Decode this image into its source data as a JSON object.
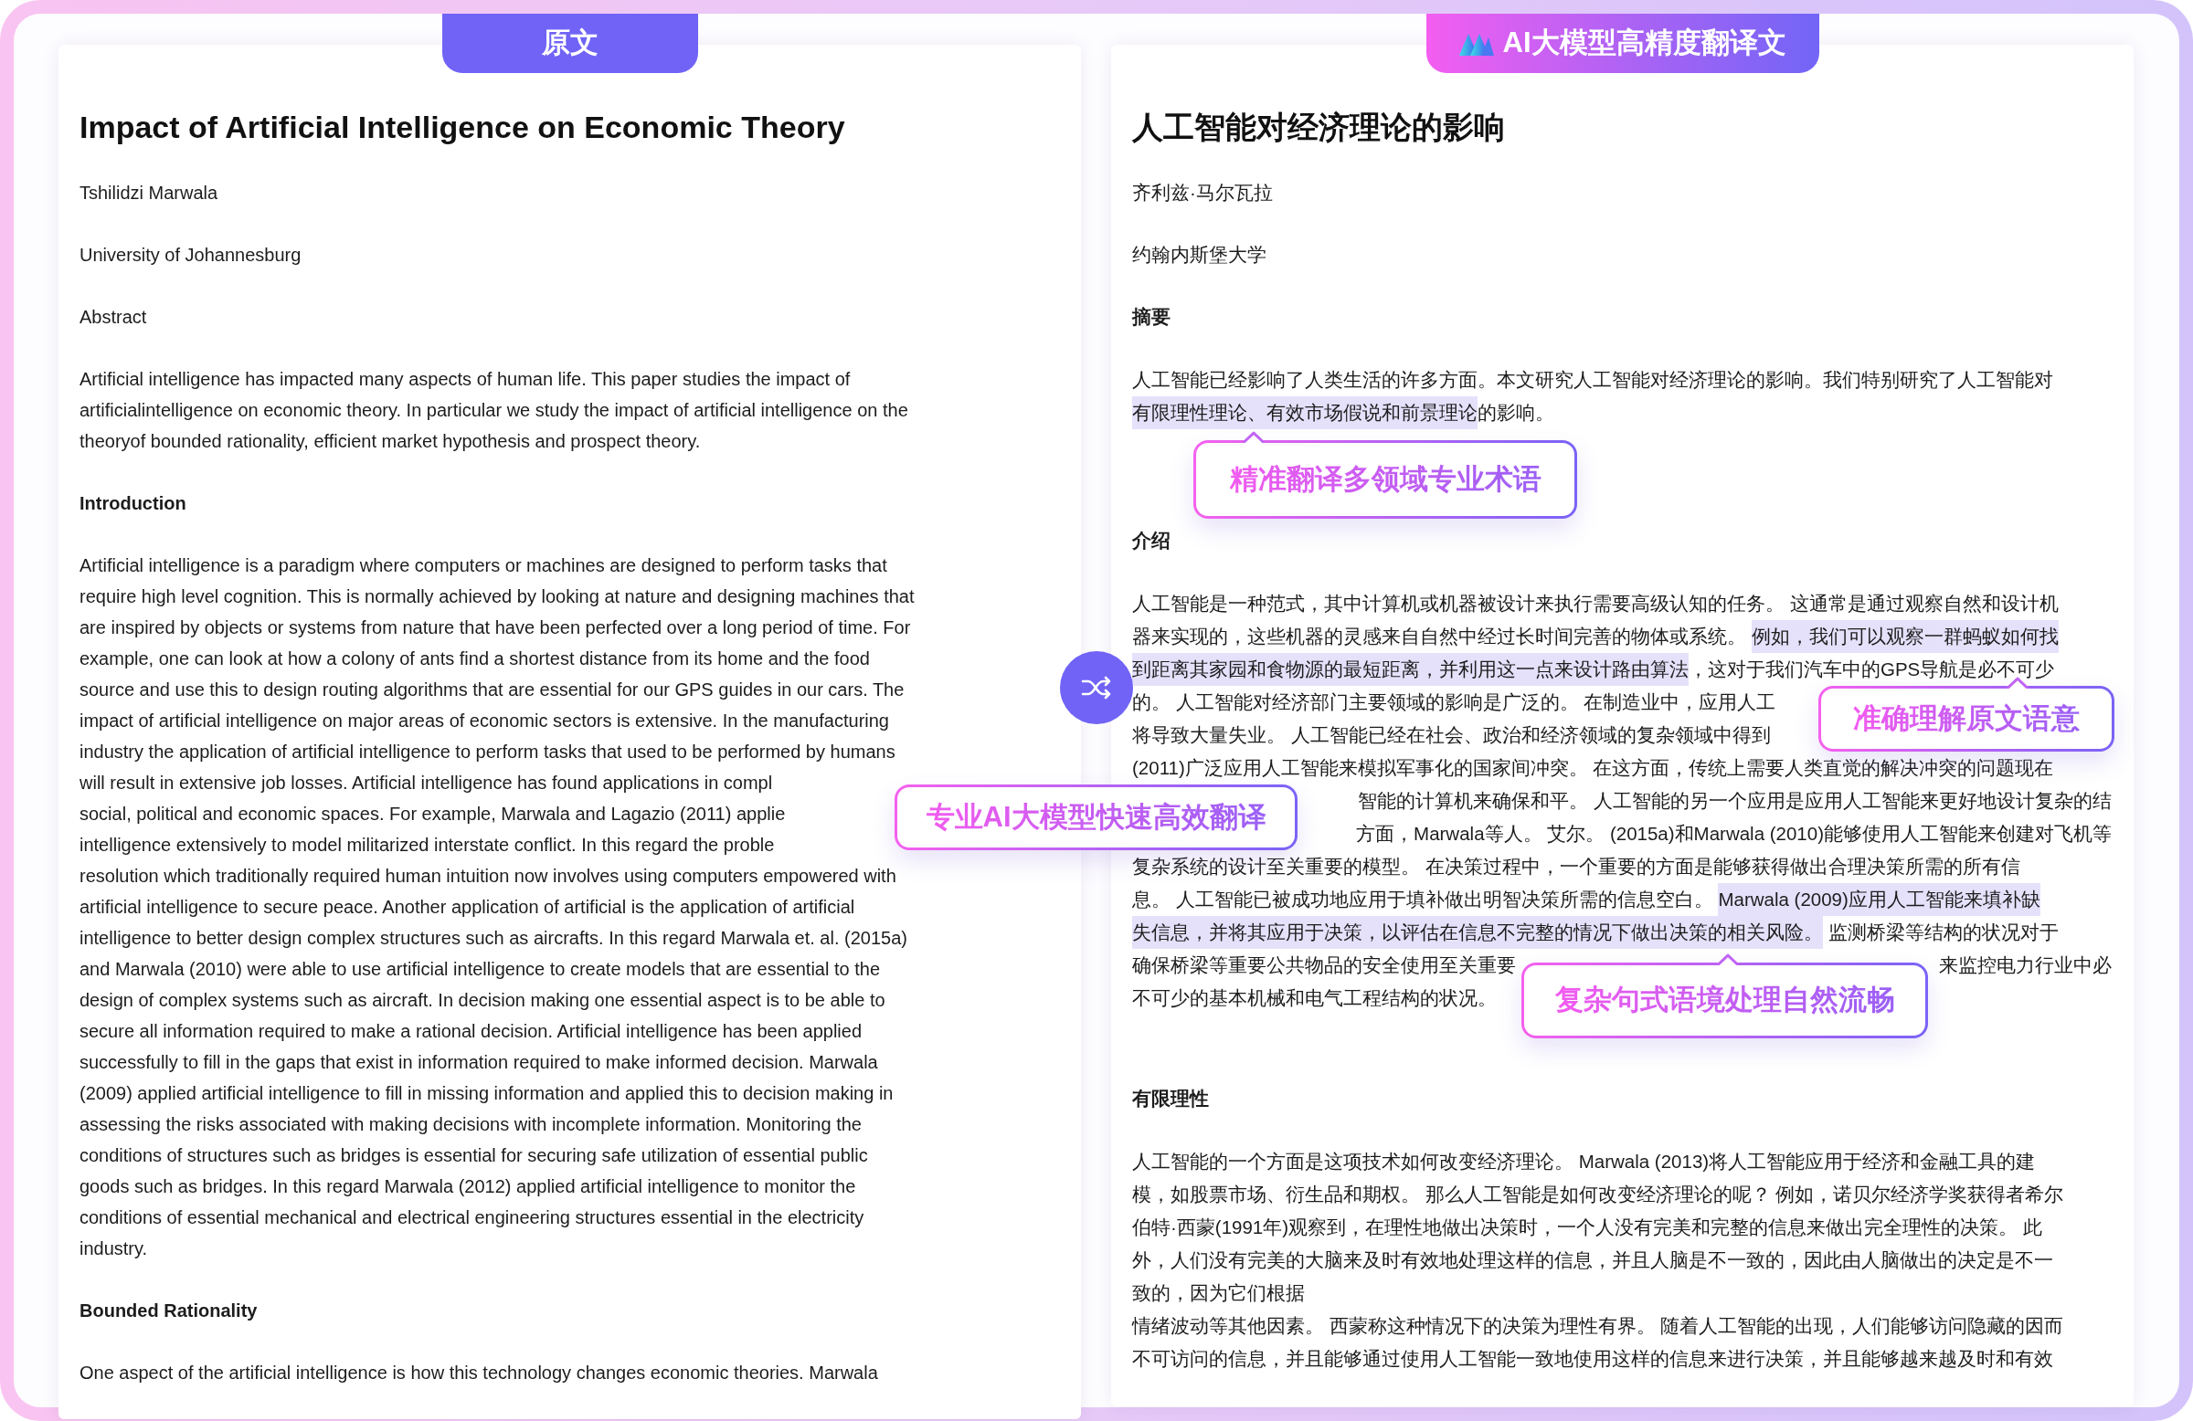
{
  "panels": [
    {
      "header": {
        "title": "原文",
        "logo": false
      },
      "title": "Impact of Artificial Intelligence on Economic Theory",
      "blocks": [
        {
          "kind": "line",
          "text": "Tshilidzi Marwala"
        },
        {
          "kind": "line",
          "text": "University of Johannesburg"
        },
        {
          "kind": "line",
          "text": "Abstract"
        },
        {
          "kind": "paragraph",
          "lines": [
            "Artificial intelligence has impacted many aspects of human life. This paper studies the impact of",
            "artificialintelligence on economic theory. In particular we study the impact of artificial intelligence on the",
            "theoryof bounded rationality, efficient market hypothesis and prospect theory."
          ]
        },
        {
          "kind": "heading",
          "text": "Introduction"
        },
        {
          "kind": "paragraph",
          "lines": [
            "Artificial intelligence is a paradigm where computers or machines are designed to perform tasks that",
            "require high level cognition. This is normally achieved by looking at nature and designing machines that",
            "are inspired by objects or systems from nature that have been perfected over a long period of time. For",
            "example, one can look at how a colony of ants find a shortest distance from its home and the food",
            "source and use this to design routing algorithms that are essential for our GPS guides in our cars. The",
            "impact of artificial intelligence on major areas of economic sectors is extensive. In the manufacturing",
            "industry the application of artificial intelligence to perform tasks that used to be performed by humans",
            {
              "kind": "cut_end",
              "text": "will result in extensive job losses. Artificial intelligence has found applications in compl"
            },
            {
              "kind": "cut_end",
              "text": "social, political and economic spaces. For example, Marwala and Lagazio (2011) applie"
            },
            {
              "kind": "cut_end",
              "text": "intelligence extensively to model militarized interstate conflict. In this regard the proble"
            },
            "resolution which traditionally required human intuition now involves using computers empowered with",
            "artificial intelligence to secure peace. Another application of artificial is the application of artificial",
            "intelligence to better design complex structures such as aircrafts. In this regard Marwala et. al. (2015a)",
            "and Marwala (2010) were able to use artificial intelligence to create models that are essential to the",
            "design of complex systems such as aircraft. In decision making one essential aspect is to be able to",
            "secure all information required to make a rational decision. Artificial intelligence has been applied",
            "successfully to fill in the gaps that exist in information required to make informed decision. Marwala",
            "(2009) applied artificial intelligence to fill in missing information and applied this to decision making in",
            "assessing the risks associated with making decisions with incomplete information. Monitoring the",
            "conditions of structures such as bridges is essential for securing safe utilization of essential public",
            "goods such as bridges. In this regard Marwala (2012) applied artificial intelligence to monitor the",
            "conditions of essential mechanical and electrical engineering structures essential in the electricity",
            "industry."
          ]
        },
        {
          "kind": "heading",
          "text": "Bounded Rationality"
        },
        {
          "kind": "paragraph",
          "lines": [
            "One aspect of the artificial intelligence is how this technology changes economic theories. Marwala"
          ]
        }
      ]
    },
    {
      "header": {
        "title": "AI大模型高精度翻译文",
        "logo": true
      },
      "title": "人工智能对经济理论的影响",
      "blocks": [
        {
          "kind": "line",
          "text": "齐利兹·马尔瓦拉"
        },
        {
          "kind": "line",
          "text": "约翰内斯堡大学"
        },
        {
          "kind": "heading",
          "text": "摘要"
        },
        {
          "kind": "paragraph",
          "lines": [
            "人工智能已经影响了人类生活的许多方面。本文研究人工智能对经济理论的影响。我们特别研究了人工智能对",
            {
              "segments": [
                {
                  "text": "有限理性理论、有效市场假说和前景理论",
                  "highlighted": true
                },
                {
                  "text": "的影响。",
                  "highlighted": false
                }
              ]
            }
          ]
        },
        {
          "kind": "callout",
          "text": "精准翻译多领域专业术语",
          "pointer": true
        },
        {
          "kind": "heading",
          "text": "介绍"
        },
        {
          "kind": "paragraph",
          "lines": [
            "人工智能是一种范式，其中计算机或机器被设计来执行需要高级认知的任务。 这通常是通过观察自然和设计机",
            {
              "segments": [
                {
                  "text": "器来实现的，这些机器的灵感来自自然中经过长时间完善的物体或系统。 ",
                  "highlighted": false
                },
                {
                  "text": "例如，我们可以观察一群蚂蚁如何找",
                  "highlighted": true
                }
              ]
            },
            {
              "segments": [
                {
                  "text": "到距离其家园和食物源的最短距离，并利用这一点来设计路由算法",
                  "highlighted": true
                },
                {
                  "text": "，这对于我们汽车中的GPS导航是必不可少",
                  "highlighted": false
                }
              ]
            },
            {
              "kind": "cut_end",
              "text": "的。 人工智能对经济部门主要领域的影响是广泛的。 在制造业中，应用人工"
            },
            {
              "kind": "cut_end",
              "text": "将导致大量失业。 人工智能已经在社会、政治和经济领域的复杂领域中得到"
            },
            "(2011)广泛应用人工智能来模拟军事化的国家间冲突。 在这方面，传统上需要人类直觉的解决冲突的问题现在",
            {
              "kind": "cut_start",
              "text": "智能的计算机来确保和平。 人工智能的另一个应用是应用人工智能来更好地设计复杂的结"
            },
            {
              "kind": "cut_start",
              "text": "方面，Marwala等人。 艾尔。 (2015a)和Marwala (2010)能够使用人工智能来创建对飞机等"
            },
            "复杂系统的设计至关重要的模型。 在决策过程中，一个重要的方面是能够获得做出合理决策所需的所有信",
            {
              "segments": [
                {
                  "text": "息。 人工智能已被成功地应用于填补做出明智决策所需的信息空白。 ",
                  "highlighted": false
                },
                {
                  "text": "Marwala (2009)应用人工智能来填补缺",
                  "highlighted": true
                }
              ]
            },
            {
              "segments": [
                {
                  "text": "失信息，并将其应用于决策，以评估在信息不完整的情况下做出决策的相关风险。",
                  "highlighted": true
                },
                {
                  "text": " 监测桥梁等结构的状况对于",
                  "highlighted": false
                }
              ]
            },
            {
              "kind": "cut_middle",
              "parts": [
                "确保桥梁等重要公共物品的安全使用至关重要",
                "来监控电力行业中必"
              ]
            },
            "不可少的基本机械和电气工程结构的状况。"
          ]
        },
        {
          "kind": "callout",
          "text": "复杂句式语境处理自然流畅",
          "pointer": true
        },
        {
          "kind": "heading",
          "text": "有限理性"
        },
        {
          "kind": "paragraph",
          "lines": [
            "人工智能的一个方面是这项技术如何改变经济理论。 Marwala (2013)将人工智能应用于经济和金融工具的建",
            "模，如股票市场、衍生品和期权。 那么人工智能是如何改变经济理论的呢？ 例如，诺贝尔经济学奖获得者希尔",
            "伯特·西蒙(1991年)观察到，在理性地做出决策时，一个人没有完美和完整的信息来做出完全理性的决策。 此",
            "外，人们没有完美的大脑来及时有效地处理这样的信息，并且人脑是不一致的，因此由人脑做出的决定是不一",
            "致的，因为它们根据",
            "情绪波动等其他因素。 西蒙称这种情况下的决策为理性有界。 随着人工智能的出现，人们能够访问隐藏的因而",
            "不可访问的信息，并且能够通过使用人工智能一致地使用这样的信息来进行决策，并且能够越来越及时和有效"
          ]
        }
      ]
    }
  ],
  "callouts": [
    {
      "text": "专业AI大模型快速高效翻译",
      "pointer": false
    },
    {
      "text": "准确理解原文语意",
      "pointer": true
    }
  ]
}
